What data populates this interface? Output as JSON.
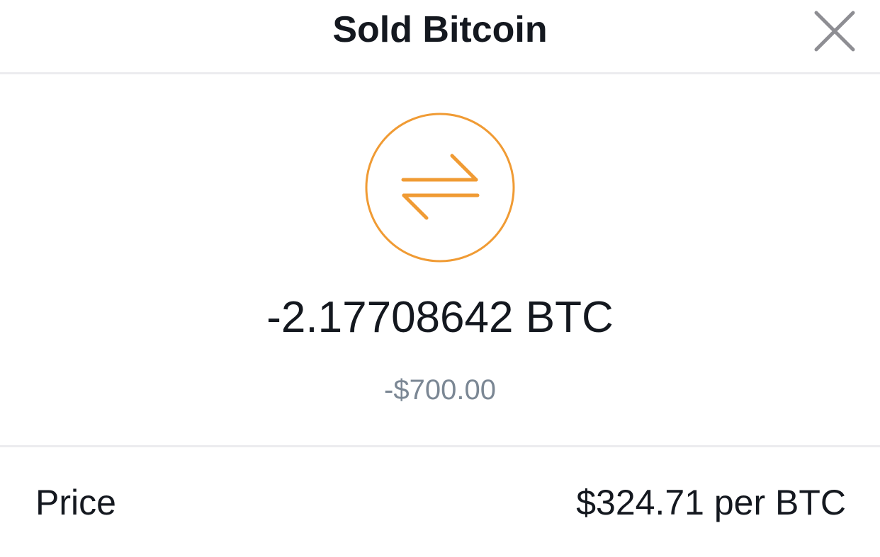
{
  "header": {
    "title": "Sold Bitcoin",
    "close_icon": "close-icon"
  },
  "transaction": {
    "icon": "swap-arrows-icon",
    "accent_color": "#f09b34",
    "amount_crypto": "-2.17708642 BTC",
    "amount_fiat": "-$700.00"
  },
  "details": [
    {
      "label": "Price",
      "value": "$324.71 per BTC"
    }
  ]
}
